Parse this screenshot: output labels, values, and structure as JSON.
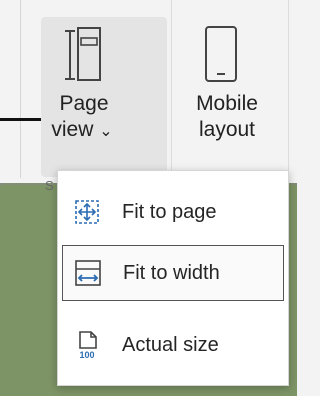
{
  "ribbon": {
    "page_view": {
      "line1": "Page",
      "line2": "view",
      "caret": "⌄"
    },
    "mobile_layout": {
      "line1": "Mobile",
      "line2": "layout"
    },
    "group_label_fragment": "S"
  },
  "menu": {
    "items": [
      {
        "label": "Fit to page",
        "icon": "fit-to-page-icon",
        "selected": false
      },
      {
        "label": "Fit to width",
        "icon": "fit-to-width-icon",
        "selected": true
      },
      {
        "label": "Actual size",
        "icon": "actual-size-icon",
        "selected": false
      }
    ],
    "actual_size_icon_text": "100"
  },
  "colors": {
    "accent_blue": "#2b6cb3",
    "document_background": "#7d9466",
    "ribbon_background": "#f3f3f3"
  }
}
